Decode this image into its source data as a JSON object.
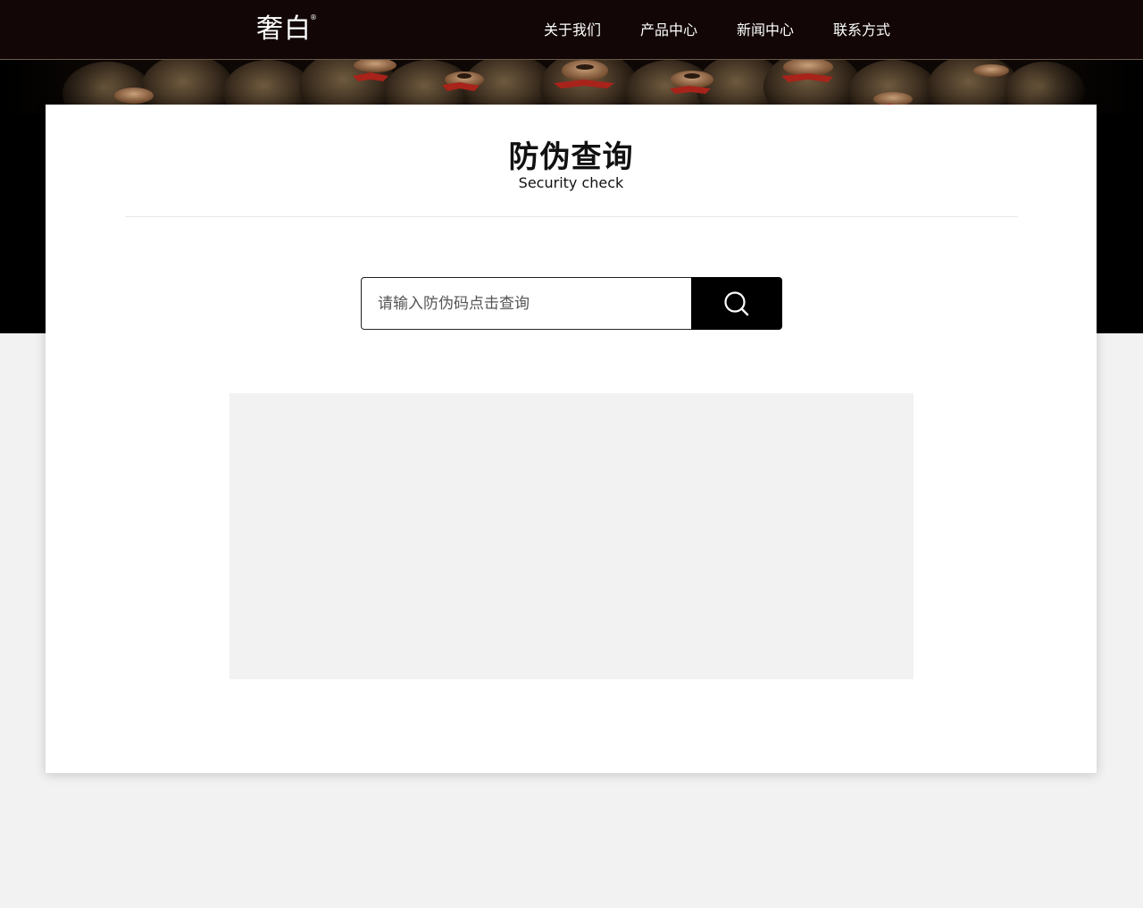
{
  "header": {
    "logo": "奢白",
    "logo_mark": "®",
    "nav": [
      {
        "label": "关于我们"
      },
      {
        "label": "产品中心"
      },
      {
        "label": "新闻中心"
      },
      {
        "label": "联系方式"
      }
    ]
  },
  "banner": {
    "image": "wine-jars-photo"
  },
  "main": {
    "title": "防伪查询",
    "subtitle": "Security check",
    "search": {
      "placeholder": "请输入防伪码点击查询",
      "value": "",
      "button_icon": "search-icon"
    }
  },
  "colors": {
    "header_bg": "#120606",
    "banner_bg": "#000000",
    "page_bg": "#f2f2f2",
    "card_bg": "#ffffff",
    "button_bg": "#000000",
    "result_panel_bg": "#f2f2f2"
  }
}
